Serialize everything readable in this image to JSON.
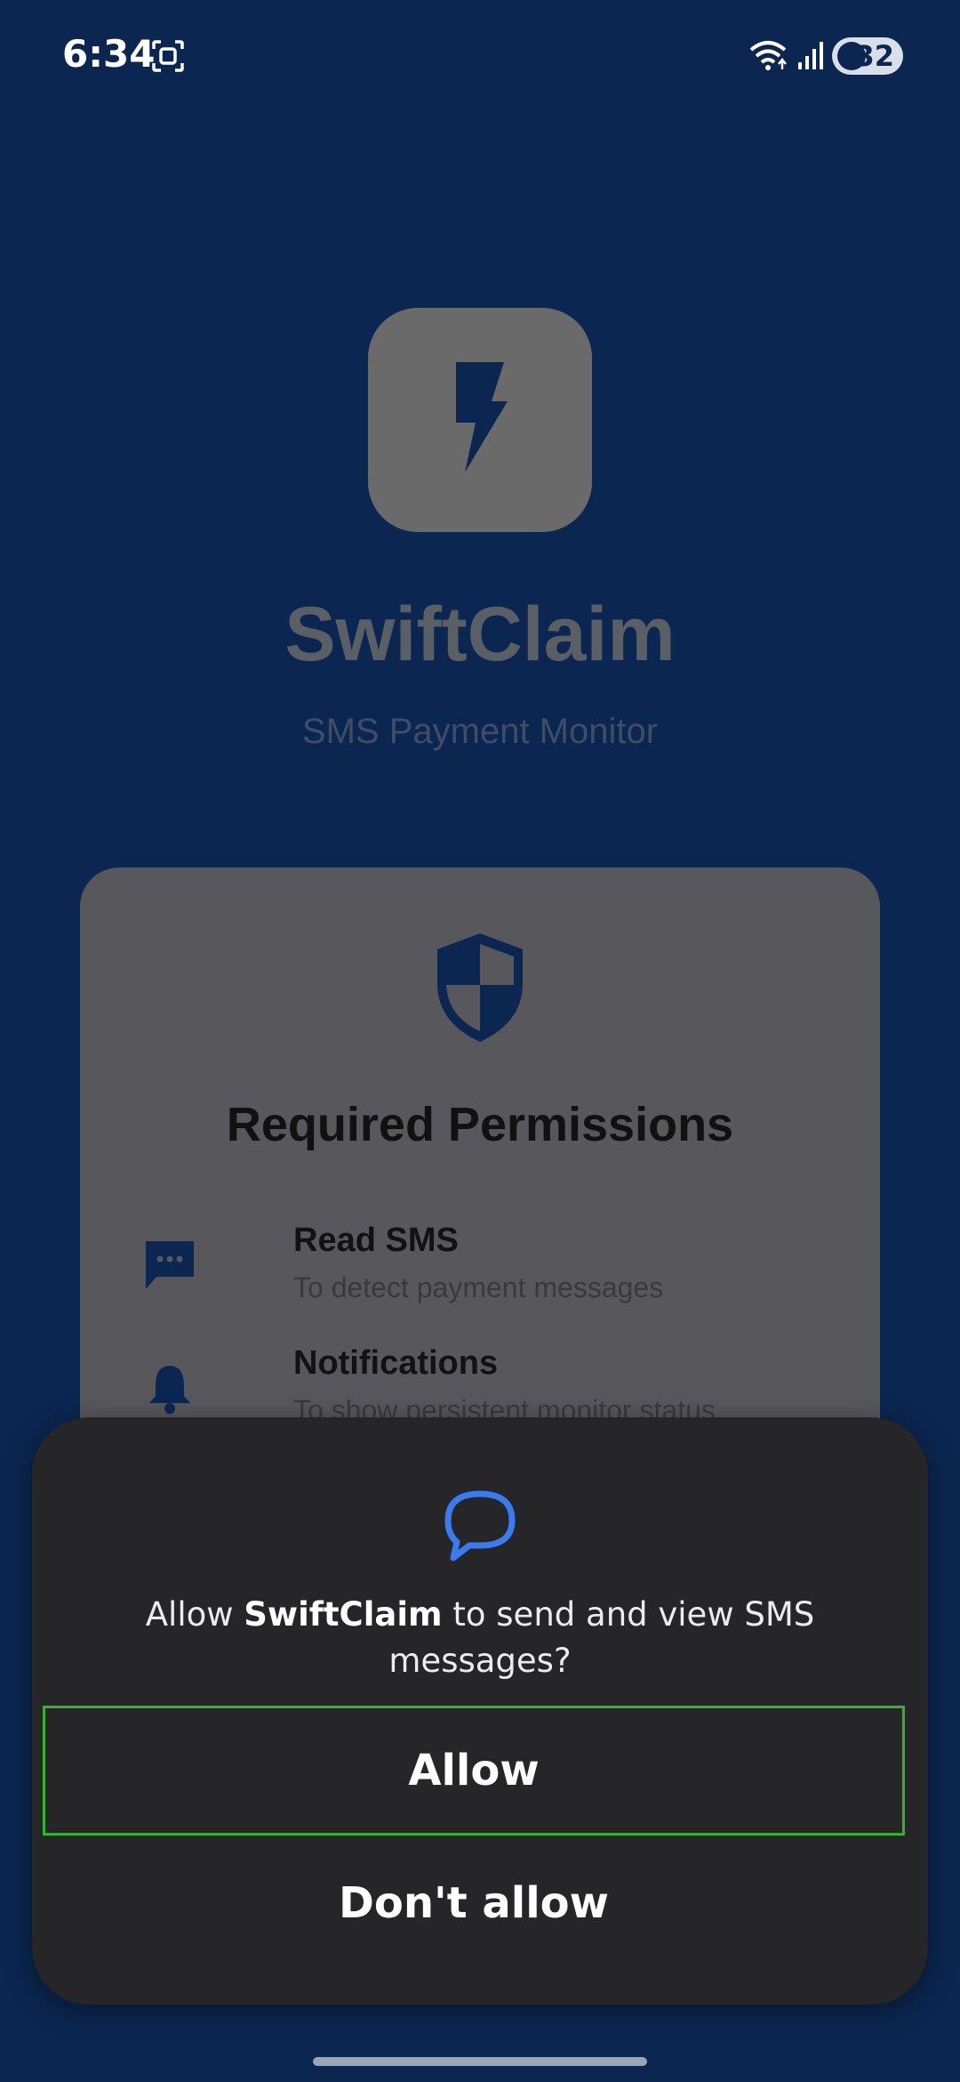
{
  "status_bar": {
    "time": "6:34",
    "battery": "32"
  },
  "app": {
    "title": "SwiftClaim",
    "subtitle": "SMS Payment Monitor",
    "permissions_card": {
      "title": "Required Permissions",
      "items": [
        {
          "label": "Read SMS",
          "desc": "To detect payment messages",
          "icon": "sms-icon"
        },
        {
          "label": "Notifications",
          "desc": "To show persistent monitor status",
          "icon": "bell-icon"
        }
      ]
    }
  },
  "dialog": {
    "message_prefix": "Allow ",
    "app_name": "SwiftClaim",
    "message_suffix": " to send and view SMS messages?",
    "allow_label": "Allow",
    "deny_label": "Don't allow",
    "icon": "chat-bubble-icon"
  },
  "colors": {
    "background": "#0b2650",
    "dialog": "#262628",
    "accent": "#3b7bf0",
    "focus_border": "#32b52c"
  }
}
